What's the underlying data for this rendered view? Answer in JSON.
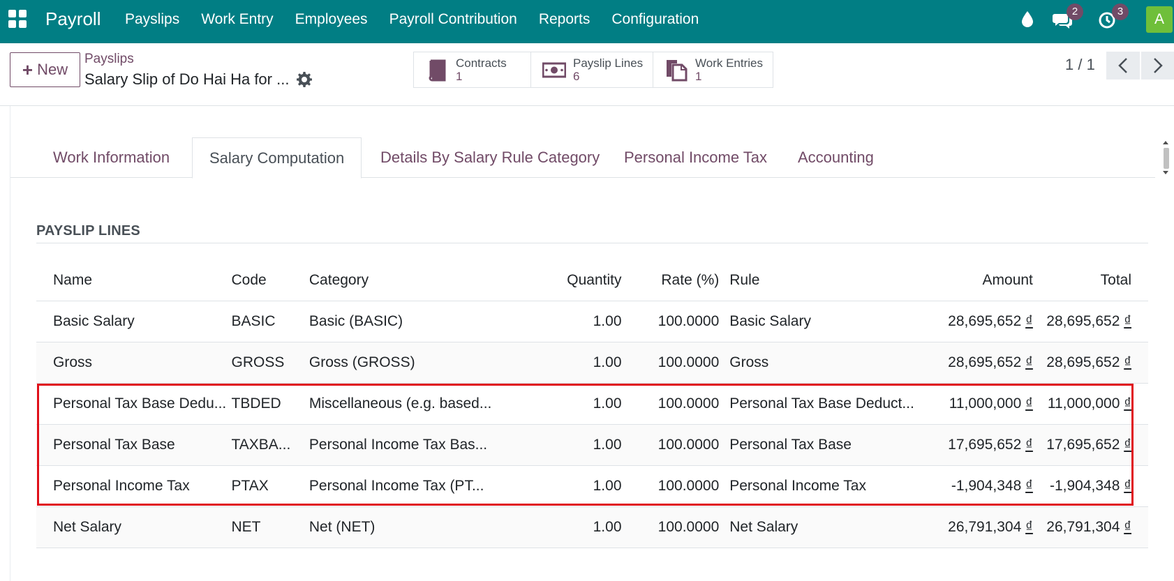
{
  "navbar": {
    "app_name": "Payroll",
    "menu": [
      "Payslips",
      "Work Entry",
      "Employees",
      "Payroll Contribution",
      "Reports",
      "Configuration"
    ],
    "chat_badge": "2",
    "activity_badge": "3",
    "avatar_letter": "A",
    "color": "#017e84"
  },
  "control": {
    "new_label": "New",
    "breadcrumb": "Payslips",
    "title": "Salary Slip of Do Hai Ha for ...",
    "smart_buttons": [
      {
        "label": "Contracts",
        "value": "1",
        "icon": "book-icon"
      },
      {
        "label": "Payslip Lines",
        "value": "6",
        "icon": "money-icon"
      },
      {
        "label": "Work Entries",
        "value": "1",
        "icon": "documents-icon"
      }
    ],
    "pager": "1 / 1"
  },
  "tabs": [
    "Work Information",
    "Salary Computation",
    "Details By Salary Rule Category",
    "Personal Income Tax",
    "Accounting"
  ],
  "active_tab": "Salary Computation",
  "section_title": "PAYSLIP LINES",
  "table": {
    "headers": {
      "name": "Name",
      "code": "Code",
      "category": "Category",
      "quantity": "Quantity",
      "rate": "Rate (%)",
      "rule": "Rule",
      "amount": "Amount",
      "total": "Total"
    },
    "rows": [
      {
        "name": "Basic Salary",
        "code": "BASIC",
        "category": "Basic (BASIC)",
        "quantity": "1.00",
        "rate": "100.0000",
        "rule": "Basic Salary",
        "amount": "28,695,652",
        "total": "28,695,652"
      },
      {
        "name": "Gross",
        "code": "GROSS",
        "category": "Gross (GROSS)",
        "quantity": "1.00",
        "rate": "100.0000",
        "rule": "Gross",
        "amount": "28,695,652",
        "total": "28,695,652"
      },
      {
        "name": "Personal Tax Base Dedu...",
        "code": "TBDED",
        "category": "Miscellaneous (e.g. based...",
        "quantity": "1.00",
        "rate": "100.0000",
        "rule": "Personal Tax Base Deduct...",
        "amount": "11,000,000",
        "total": "11,000,000"
      },
      {
        "name": "Personal Tax Base",
        "code": "TAXBA...",
        "category": "Personal Income Tax Bas...",
        "quantity": "1.00",
        "rate": "100.0000",
        "rule": "Personal Tax Base",
        "amount": "17,695,652",
        "total": "17,695,652"
      },
      {
        "name": "Personal Income Tax",
        "code": "PTAX",
        "category": "Personal Income Tax (PT...",
        "quantity": "1.00",
        "rate": "100.0000",
        "rule": "Personal Income Tax",
        "amount": "-1,904,348",
        "total": "-1,904,348"
      },
      {
        "name": "Net Salary",
        "code": "NET",
        "category": "Net (NET)",
        "quantity": "1.00",
        "rate": "100.0000",
        "rule": "Net Salary",
        "amount": "26,791,304",
        "total": "26,791,304"
      }
    ],
    "currency_symbol": "₫"
  },
  "highlight_color": "#e0101a"
}
